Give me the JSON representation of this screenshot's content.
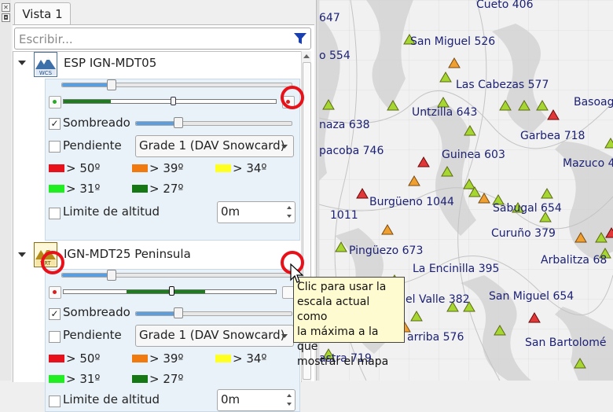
{
  "panel": {
    "tab_label": "Vista 1",
    "search_placeholder": "Escribir...",
    "layers": [
      {
        "name": "ESP IGN-MDT05",
        "badge": "WCS",
        "sombreado_label": "Sombreado",
        "sombreado_checked": "✓",
        "pendiente_label": "Pendiente",
        "grade_value": "Grade 1 (DAV Snowcard)",
        "legend": [
          "> 50º",
          "> 39º",
          "> 34º",
          "> 31º",
          "> 27º"
        ],
        "limite_label": "Limite de altitud",
        "altitude_value": "0m"
      },
      {
        "name": "IGN-MDT25 Peninsula",
        "badge": "VRT",
        "sombreado_label": "Sombreado",
        "sombreado_checked": "✓",
        "pendiente_label": "Pendiente",
        "grade_value": "Grade 1 (DAV Snowcard)",
        "legend": [
          "> 50º",
          "> 39º",
          "> 34º",
          "> 31º",
          "> 27º"
        ],
        "limite_label": "Limite de altitud",
        "altitude_value": "0m"
      }
    ],
    "legend_colors": [
      "#e8101a",
      "#f07a10",
      "#ffff20",
      "#20ee20",
      "#157815"
    ]
  },
  "tooltip": {
    "lines": [
      "Clic para usar la",
      "escala actual como",
      "la máxima a la que",
      "mostrar el mapa"
    ]
  },
  "map": {
    "peaks": [
      {
        "name": "647"
      },
      {
        "name": "Cueto  406"
      },
      {
        "name": "San Miguel 526"
      },
      {
        "name": "o 554"
      },
      {
        "name": "Las Cabezas 577"
      },
      {
        "name": "Basoag"
      },
      {
        "name": "Untzilla 643"
      },
      {
        "name": "naza 638"
      },
      {
        "name": "Garbea 718"
      },
      {
        "name": "pacoba 746"
      },
      {
        "name": "Guinea 603"
      },
      {
        "name": "Mazuco 4"
      },
      {
        "name": "Burgüeno 1044"
      },
      {
        "name": "Sabugal 654"
      },
      {
        "name": "1011"
      },
      {
        "name": "Curuño 379"
      },
      {
        "name": "Pingüezo 673"
      },
      {
        "name": "Arbalitza 68"
      },
      {
        "name": "La Encinilla 395"
      },
      {
        "name": "el Valle 382"
      },
      {
        "name": "San Miguel 654"
      },
      {
        "name": "arriba 576"
      },
      {
        "name": "San Bartolomé"
      },
      {
        "name": "astra 719"
      }
    ]
  }
}
